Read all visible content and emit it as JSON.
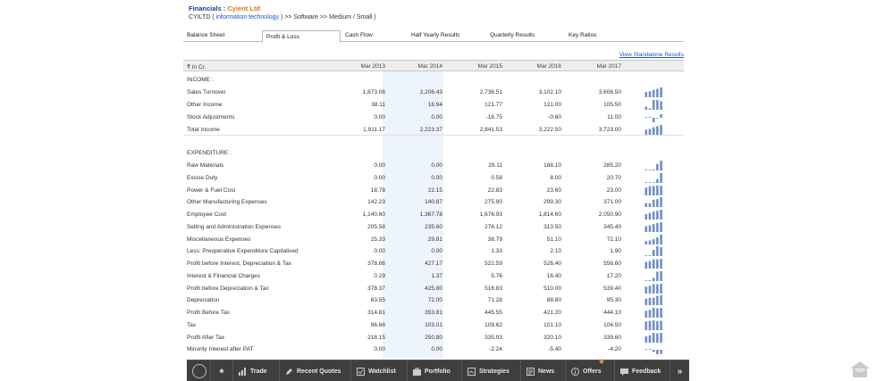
{
  "header": {
    "label": "Financials :",
    "company": "Cyient Ltd",
    "ticker": "CYILTD (",
    "sector_link": "information technology",
    "path": ") >> Software >> Medium / Small )"
  },
  "tabs": [
    {
      "label": "Balance Sheet"
    },
    {
      "label": "Profit & Loss"
    },
    {
      "label": "Cash Flow"
    },
    {
      "label": "Half Yearly Results"
    },
    {
      "label": "Quarterly Results"
    },
    {
      "label": "Key Ratios"
    }
  ],
  "view_link": "View Standalone Results",
  "table": {
    "unit": "₹ in Cr.",
    "years": [
      "Mar 2013",
      "Mar 2014",
      "Mar 2015",
      "Mar 2016",
      "Mar 2017"
    ],
    "income_heading": "INCOME :",
    "expenditure_heading": "EXPENDITURE :",
    "income": [
      {
        "label": "Sales Turnover",
        "values": [
          "1,873.06",
          "2,206.43",
          "2,736.51",
          "3,102.10",
          "3,606.50"
        ]
      },
      {
        "label": "Other Income",
        "values": [
          "38.11",
          "16.94",
          "121.77",
          "121.00",
          "105.50"
        ]
      },
      {
        "label": "Stock Adjustments",
        "values": [
          "0.00",
          "0.00",
          "-16.75",
          "-0.60",
          "11.00"
        ]
      },
      {
        "label": "Total Income",
        "values": [
          "1,911.17",
          "2,223.37",
          "2,841.53",
          "3,222.50",
          "3,723.00"
        ]
      }
    ],
    "expenditure": [
      {
        "label": "Raw Materials",
        "values": [
          "0.00",
          "0.00",
          "29.11",
          "188.10",
          "285.20"
        ]
      },
      {
        "label": "Excise Duty",
        "values": [
          "0.00",
          "0.00",
          "0.58",
          "8.00",
          "20.70"
        ]
      },
      {
        "label": "Power & Fuel Cost",
        "values": [
          "18.78",
          "22.15",
          "22.83",
          "23.60",
          "23.00"
        ]
      },
      {
        "label": "Other Manufacturing Expenses",
        "values": [
          "142.23",
          "140.87",
          "275.90",
          "299.30",
          "371.00"
        ]
      },
      {
        "label": "Employee Cost",
        "values": [
          "1,140.60",
          "1,367.78",
          "1,676.93",
          "1,814.60",
          "2,050.90"
        ]
      },
      {
        "label": "Selling and Administration Expenses",
        "values": [
          "205.58",
          "235.60",
          "276.12",
          "313.50",
          "345.40"
        ]
      },
      {
        "label": "Miscellaneous Expenses",
        "values": [
          "25.33",
          "29.81",
          "38.79",
          "51.10",
          "72.10"
        ]
      },
      {
        "label": "Less: Preoperative Expenditure Capitalised",
        "values": [
          "0.00",
          "0.00",
          "1.33",
          "2.10",
          "1.90"
        ]
      },
      {
        "label": "Profit before Interest, Depreciation & Tax",
        "values": [
          "378.66",
          "427.17",
          "522.59",
          "526.40",
          "556.60"
        ]
      },
      {
        "label": "Interest & Financial Charges",
        "values": [
          "0.29",
          "1.37",
          "5.76",
          "16.40",
          "17.20"
        ]
      },
      {
        "label": "Profit before Depreciation & Tax",
        "values": [
          "378.37",
          "425.80",
          "516.83",
          "510.00",
          "539.40"
        ]
      },
      {
        "label": "Depreciation",
        "values": [
          "63.55",
          "72.00",
          "71.28",
          "88.80",
          "95.30"
        ]
      },
      {
        "label": "Profit Before Tax",
        "values": [
          "314.81",
          "353.81",
          "445.55",
          "421.20",
          "444.10"
        ]
      },
      {
        "label": "Tax",
        "values": [
          "96.66",
          "103.01",
          "109.62",
          "101.10",
          "104.50"
        ]
      },
      {
        "label": "Profit After Tax",
        "values": [
          "218.15",
          "250.80",
          "335.93",
          "320.10",
          "339.60"
        ]
      },
      {
        "label": "Minority Interest after PAT",
        "values": [
          "0.00",
          "0.00",
          "-2.24",
          "-5.40",
          "-4.20"
        ]
      }
    ]
  },
  "bottom_bar": {
    "items": [
      {
        "label": "Trade",
        "icon": "bar-chart-icon"
      },
      {
        "label": "Recent Quotes",
        "icon": "pen-icon"
      },
      {
        "label": "Watchlist",
        "icon": "check-icon"
      },
      {
        "label": "Portfolio",
        "icon": "briefcase-icon"
      },
      {
        "label": "Strategies",
        "icon": "strategy-icon"
      },
      {
        "label": "News",
        "icon": "news-icon"
      },
      {
        "label": "Offers",
        "icon": "info-icon"
      },
      {
        "label": "Feedback",
        "icon": "feedback-icon"
      }
    ]
  },
  "top_button": "TOP",
  "colors": {
    "link": "#1e55c8",
    "company": "#e8701a",
    "spark": "#6f8fc7",
    "bar_bg": "#3e3e3e",
    "highlight": "#edf4fc"
  }
}
